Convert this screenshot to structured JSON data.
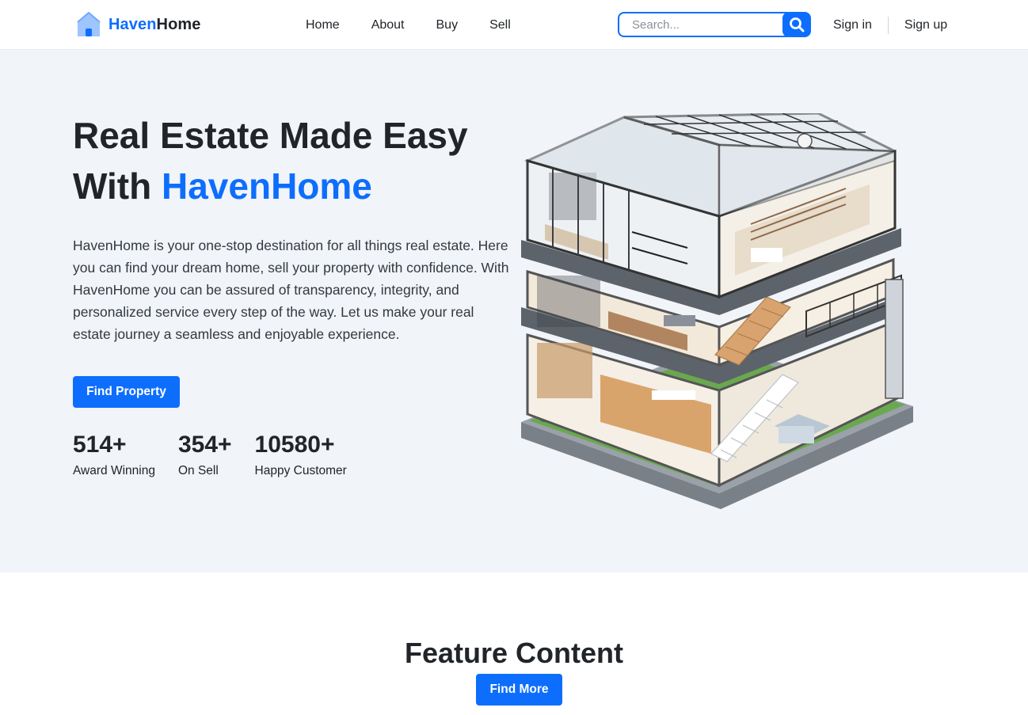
{
  "brand": {
    "part1": "Haven",
    "part2": "Home",
    "icon": "house-icon"
  },
  "nav": {
    "links": [
      "Home",
      "About",
      "Buy",
      "Sell"
    ]
  },
  "search": {
    "placeholder": "Search...",
    "icon": "search-icon"
  },
  "auth": {
    "sign_in": "Sign in",
    "sign_up": "Sign up"
  },
  "hero": {
    "title_line1": "Real Estate Made Easy",
    "title_with": "With ",
    "title_accent": "HavenHome",
    "description": "HavenHome is your one-stop destination for all things real estate. Here you can find your dream home, sell your property with confidence. With HavenHome you can be assured of transparency, integrity, and personalized service every step of the way. Let us make your real estate journey a seamless and enjoyable experience.",
    "cta": "Find Property",
    "stats": [
      {
        "value": "514+",
        "label": "Award Winning"
      },
      {
        "value": "354+",
        "label": "On Sell"
      },
      {
        "value": "10580+",
        "label": "Happy Customer"
      }
    ],
    "image": "cutaway-house-illustration"
  },
  "feature": {
    "title": "Feature Content",
    "cta": "Find More"
  },
  "colors": {
    "accent": "#0d6efd",
    "hero_bg": "#f1f4f8",
    "text": "#212529"
  }
}
